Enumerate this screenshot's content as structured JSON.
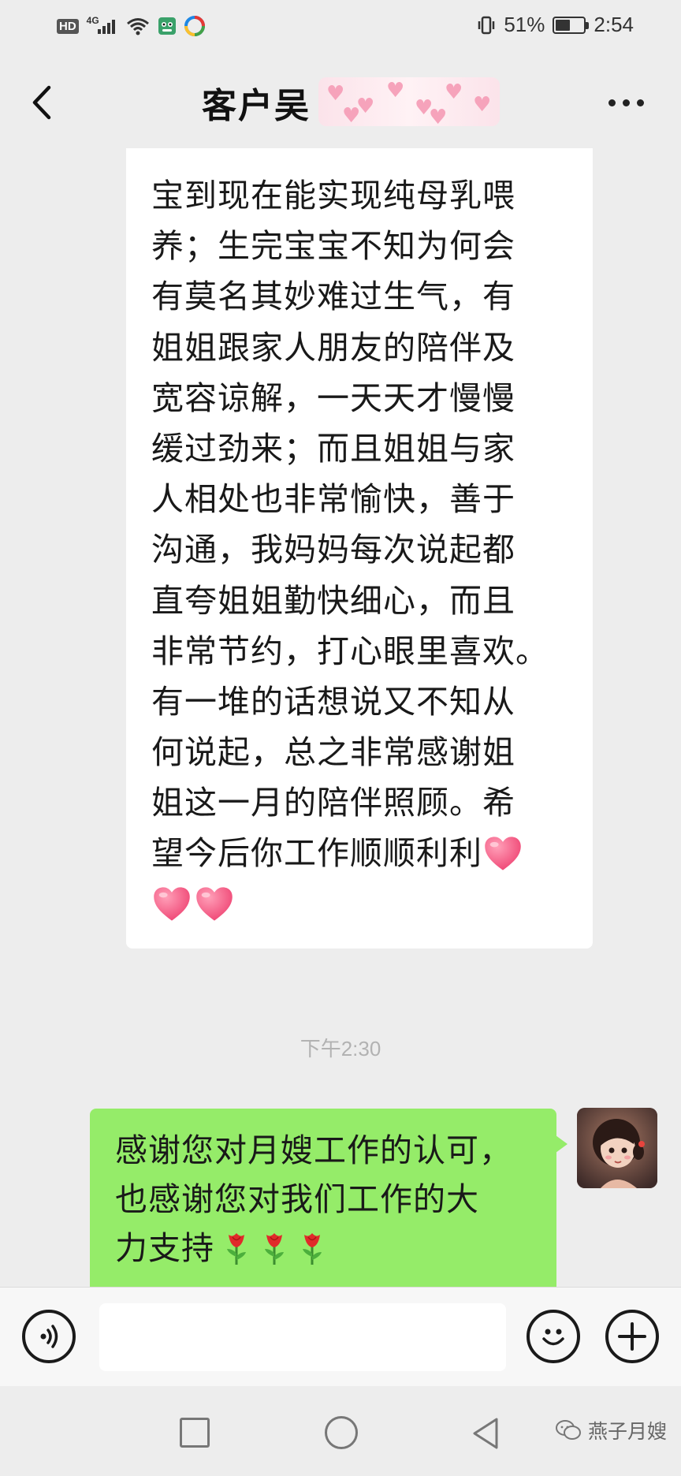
{
  "status_bar": {
    "hd": "HD",
    "network": "4G",
    "battery_text": "51%",
    "battery_level": 0.51,
    "time": "2:54"
  },
  "title_bar": {
    "title": "客户吴",
    "back_icon": "chevron-left-icon",
    "more_icon": "more-dots-icon"
  },
  "incoming_message": {
    "lines": [
      "宝到现在能实现纯母乳喂",
      "养；生完宝宝不知为何会",
      "有莫名其妙难过生气，有",
      "姐姐跟家人朋友的陪伴及",
      "宽容谅解，一天天才慢慢",
      "缓过劲来；而且姐姐与家",
      "人相处也非常愉快，善于",
      "沟通，我妈妈每次说起都",
      "直夸姐姐勤快细心，而且",
      "非常节约，打心眼里喜欢。",
      "有一堆的话想说又不知从",
      "何说起，总之非常感谢姐",
      "姐这一月的陪伴照顾。希",
      "望今后你工作顺顺利利"
    ],
    "emoji": "heart-emoji",
    "emoji_count": 3
  },
  "timestamp": "下午2:30",
  "outgoing_message": {
    "lines": [
      "感谢您对月嫂工作的认可，",
      "也感谢您对我们工作的大",
      "力支持"
    ],
    "emoji": "rose-emoji",
    "emoji_count": 3
  },
  "input_bar": {
    "voice_icon": "voice-icon",
    "emoji_icon": "emoji-face-icon",
    "plus_icon": "plus-icon",
    "placeholder": ""
  },
  "nav_bar": {
    "watermark": "燕子月嫂"
  }
}
